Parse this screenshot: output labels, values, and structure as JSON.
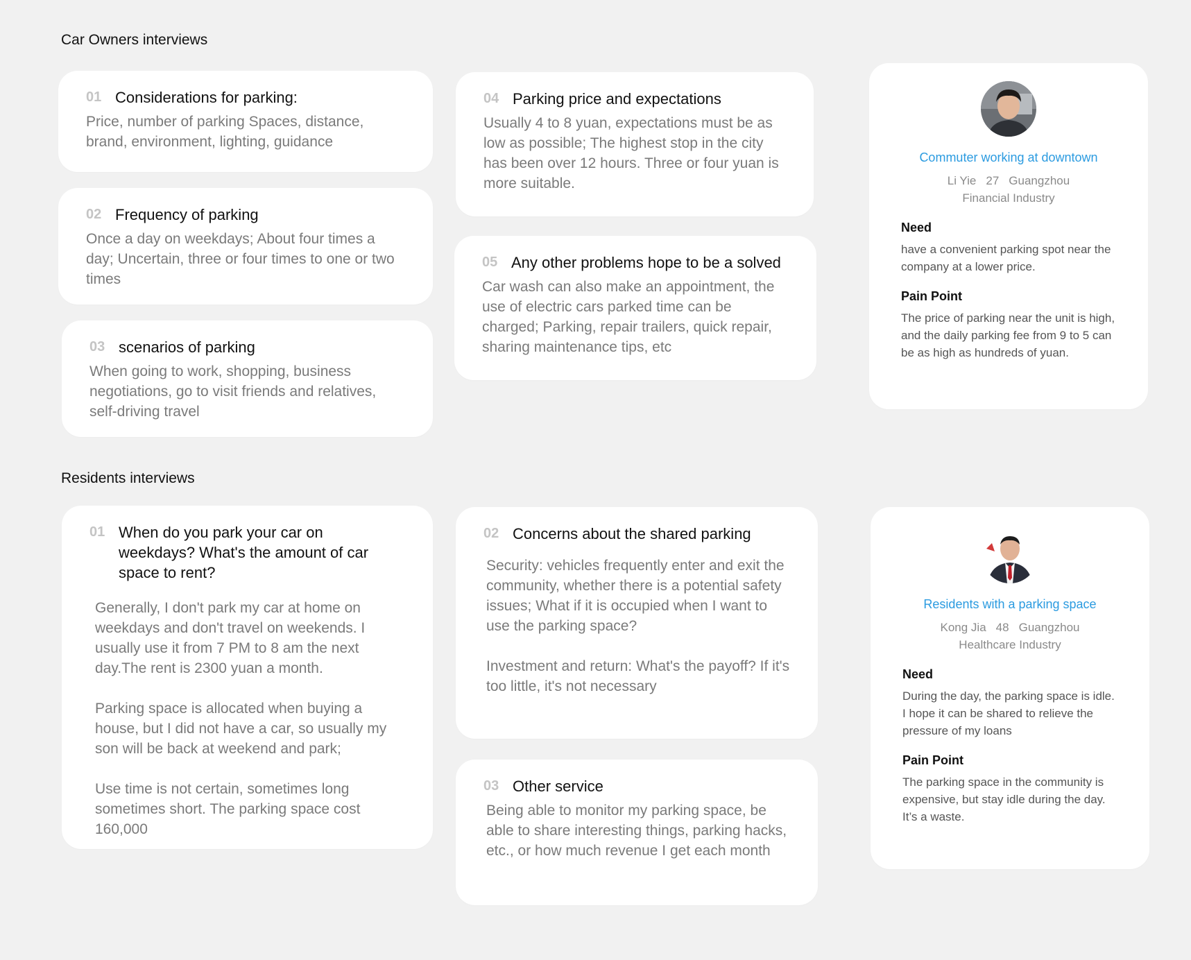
{
  "car_owners": {
    "title": "Car Owners interviews",
    "questions": [
      {
        "num": "01",
        "title": "Considerations for parking:",
        "body": [
          "Price, number of parking Spaces, distance, brand, environment, lighting, guidance"
        ]
      },
      {
        "num": "02",
        "title": "Frequency of parking",
        "body": [
          "Once a day on weekdays; About four times a day; Uncertain, three or four times to one or two times"
        ]
      },
      {
        "num": "03",
        "title": "scenarios of parking",
        "body": [
          "When going to work, shopping, business negotiations, go to visit friends and relatives, self-driving travel"
        ]
      },
      {
        "num": "04",
        "title": "Parking price and expectations",
        "body": [
          "Usually 4 to 8 yuan, expectations must be as low as possible; The highest stop in the city has been over 12 hours. Three or four yuan is more suitable."
        ]
      },
      {
        "num": "05",
        "title": "Any other problems hope to be a solved",
        "body": [
          "Car wash can also make an appointment, the use of electric cars parked time can be charged; Parking, repair trailers, quick repair, sharing maintenance tips, etc"
        ]
      }
    ],
    "persona": {
      "avatar_icon": "person-photo",
      "role": "Commuter working at downtown",
      "name": "Li Yie",
      "age": "27",
      "city": "Guangzhou",
      "industry": "Financial Industry",
      "need_label": "Need",
      "need": "have a convenient parking spot near the company at a lower price.",
      "pain_label": "Pain Point",
      "pain": "The price of parking near the unit is high, and the daily parking fee from 9 to 5 can be as high as hundreds of yuan."
    }
  },
  "residents": {
    "title": "Residents interviews",
    "questions": [
      {
        "num": "01",
        "title": "When do you park your car on weekdays? What's the amount of car space to rent?",
        "body": [
          "Generally, I don't park my car at home on weekdays and don't travel on weekends. I usually use it from 7 PM to 8 am the next day.The rent is 2300 yuan a month.",
          "Parking space is allocated when buying a house, but I did not have a car, so usually my son will be back at weekend and park;",
          "Use time is not certain, sometimes long sometimes short. The parking space cost 160,000"
        ]
      },
      {
        "num": "02",
        "title": "Concerns about the shared parking",
        "body": [
          "Security: vehicles frequently enter and exit the community, whether there is a potential safety issues; What if it is occupied when I want to use the parking space?",
          "Investment and return: What's the payoff? If it's too little, it's not necessary"
        ]
      },
      {
        "num": "03",
        "title": "Other service",
        "body": [
          "Being able to monitor my parking space, be able to share interesting things, parking hacks, etc., or how much revenue I get each month"
        ]
      }
    ],
    "persona": {
      "avatar_icon": "person-photo",
      "role": "Residents with a parking space",
      "name": "Kong Jia",
      "age": "48",
      "city": "Guangzhou",
      "industry": "Healthcare Industry",
      "need_label": "Need",
      "need": "During the day, the parking space is idle. I hope it can be shared to relieve the pressure of my loans",
      "pain_label": "Pain Point",
      "pain": "The parking space in the community is expensive, but stay idle during the day. It’s a waste."
    }
  }
}
